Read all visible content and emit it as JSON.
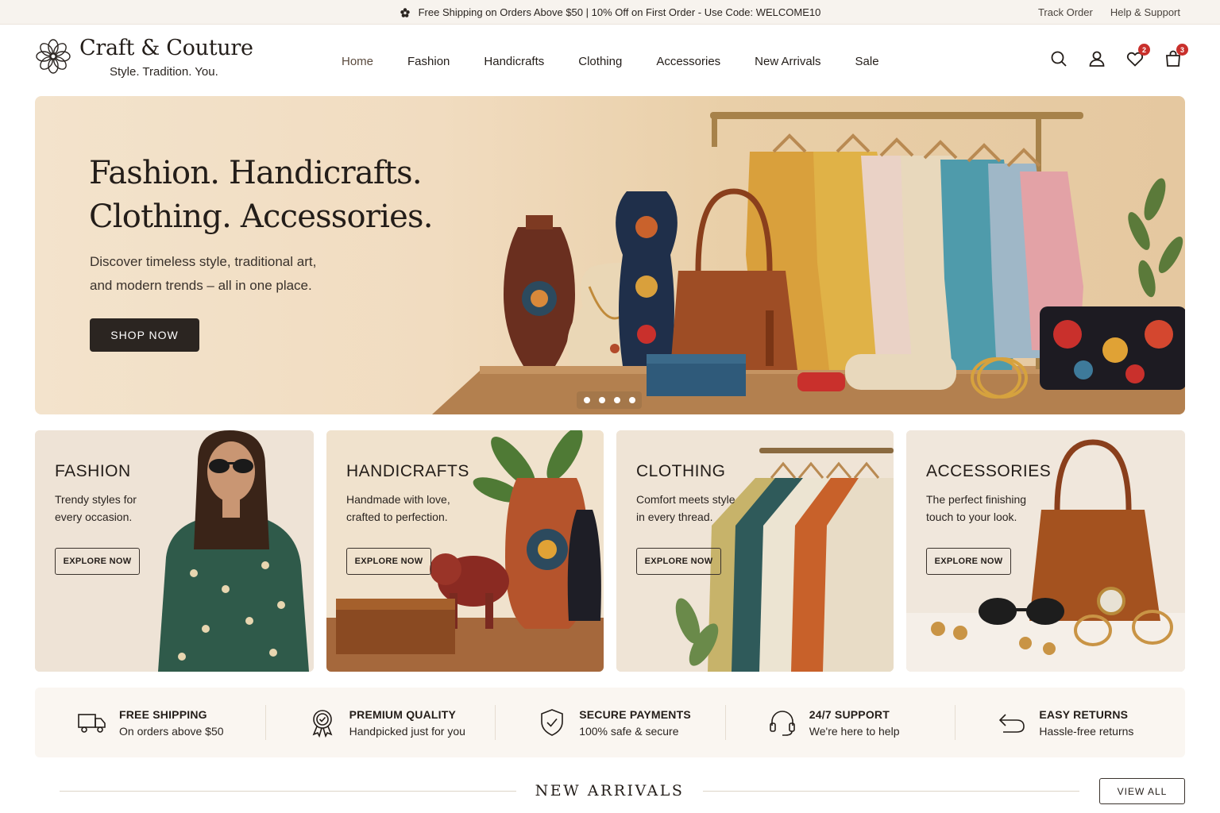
{
  "topbar": {
    "promo_text": "Free Shipping on Orders Above $50 | 10% Off on First Order - Use Code: WELCOME10",
    "track_order": "Track Order",
    "help_support": "Help & Support"
  },
  "header": {
    "brand": "Craft & Couture",
    "tagline": "Style. Tradition. You.",
    "nav": [
      "Home",
      "Fashion",
      "Handicrafts",
      "Clothing",
      "Accessories",
      "New Arrivals",
      "Sale"
    ],
    "active_nav": "Home",
    "wishlist_count": "2",
    "cart_count": "3"
  },
  "hero": {
    "title_line1": "Fashion. Handicrafts.",
    "title_line2": "Clothing. Accessories.",
    "subtitle_line1": "Discover timeless style, traditional art,",
    "subtitle_line2": "and modern trends – all in one place.",
    "cta": "SHOP NOW",
    "slide_count": 4,
    "active_slide": 1
  },
  "categories": [
    {
      "title": "FASHION",
      "desc_line1": "Trendy styles for",
      "desc_line2": "every occasion.",
      "cta": "EXPLORE NOW"
    },
    {
      "title": "HANDICRAFTS",
      "desc_line1": "Handmade with love,",
      "desc_line2": "crafted to perfection.",
      "cta": "EXPLORE NOW"
    },
    {
      "title": "CLOTHING",
      "desc_line1": "Comfort meets style",
      "desc_line2": "in every thread.",
      "cta": "EXPLORE NOW"
    },
    {
      "title": "ACCESSORIES",
      "desc_line1": "The perfect finishing",
      "desc_line2": "touch to your look.",
      "cta": "EXPLORE NOW"
    }
  ],
  "features": [
    {
      "icon": "truck-icon",
      "title": "FREE SHIPPING",
      "sub": "On orders above $50"
    },
    {
      "icon": "quality-badge-icon",
      "title": "PREMIUM QUALITY",
      "sub": "Handpicked just for you"
    },
    {
      "icon": "shield-check-icon",
      "title": "SECURE PAYMENTS",
      "sub": "100% safe & secure"
    },
    {
      "icon": "headset-icon",
      "title": "24/7 SUPPORT",
      "sub": "We're here to help"
    },
    {
      "icon": "return-arrow-icon",
      "title": "EASY RETURNS",
      "sub": "Hassle-free returns"
    }
  ],
  "new_arrivals": {
    "title": "NEW ARRIVALS",
    "view_all": "VIEW ALL"
  },
  "colors": {
    "accent_dark": "#2b2521",
    "badge_red": "#c9302c",
    "hero_bg": "#f1dcc0",
    "card_bg": "#efe3d4"
  }
}
